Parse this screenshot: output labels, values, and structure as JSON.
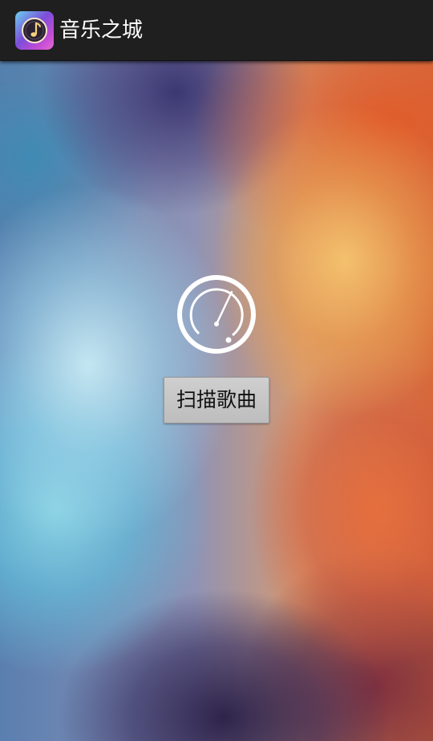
{
  "app": {
    "title": "音乐之城",
    "icon": "music-note-disc-icon"
  },
  "main": {
    "logo_icon": "dial-icon",
    "scan_button_label": "扫描歌曲"
  },
  "colors": {
    "action_bar": "#1f1f1f",
    "title_text": "#ffffff",
    "button_bg": "#c6c6c6",
    "button_text": "#111111",
    "logo": "#ffffff"
  }
}
